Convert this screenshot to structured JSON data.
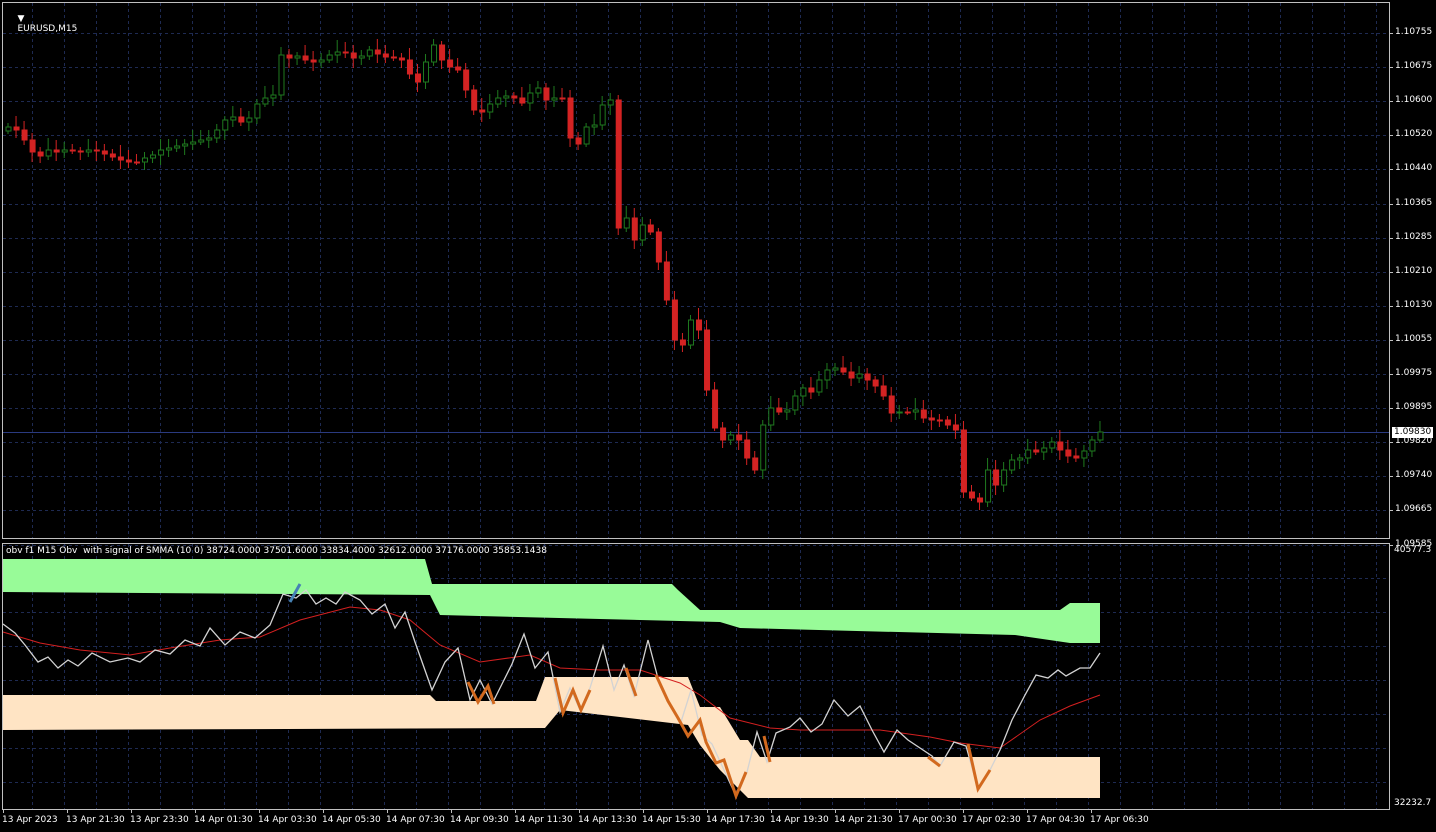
{
  "main_chart": {
    "symbol_label": "EURUSD,M15",
    "price_ticks": [
      "1.10755",
      "1.10675",
      "1.10600",
      "1.10520",
      "1.10440",
      "1.10365",
      "1.10285",
      "1.10210",
      "1.10130",
      "1.10055",
      "1.09975",
      "1.09895",
      "1.09820",
      "1.09740",
      "1.09665",
      "1.09585"
    ],
    "current_price": "1.09830",
    "candle_colors": {
      "bull": "#1f7a1f",
      "bear": "#d42323"
    }
  },
  "indicator": {
    "label": "obv f1 M15 Obv  with signal of SMMA (10 0) 38724.0000 37501.6000 33834.4000 32612.0000 37176.0000 35853.1438",
    "scale_max": "40577.3",
    "scale_min": "32232.7",
    "colors": {
      "upper_band": "#98fb98",
      "lower_band": "#ffe4c4",
      "obv_line": "#d3d3d3",
      "signal_line": "#d42020",
      "down_highlight": "#d2691e",
      "up_highlight": "#4682b4"
    }
  },
  "time_axis": [
    "13 Apr 2023",
    "13 Apr 21:30",
    "13 Apr 23:30",
    "14 Apr 01:30",
    "14 Apr 03:30",
    "14 Apr 05:30",
    "14 Apr 07:30",
    "14 Apr 09:30",
    "14 Apr 11:30",
    "14 Apr 13:30",
    "14 Apr 15:30",
    "14 Apr 17:30",
    "14 Apr 19:30",
    "14 Apr 21:30",
    "17 Apr 00:30",
    "17 Apr 02:30",
    "17 Apr 04:30",
    "17 Apr 06:30"
  ]
}
